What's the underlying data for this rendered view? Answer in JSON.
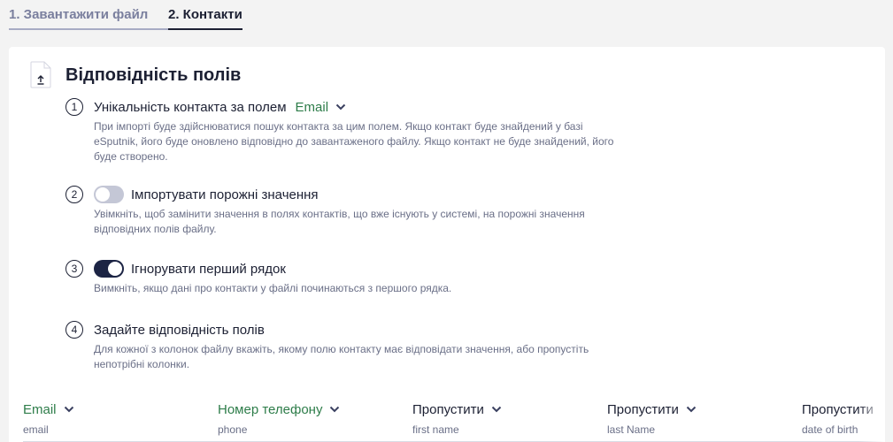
{
  "steps": [
    {
      "label": "1. Завантажити файл"
    },
    {
      "label": "2. Контакти"
    }
  ],
  "section": {
    "title": "Відповідність полів"
  },
  "items": [
    {
      "number": "1",
      "title": "Унікальність контакта за полем",
      "field_value": "Email",
      "description": "При імпорті буде здійснюватися пошук контакта за цим полем. Якщо контакт буде знайдений у базі eSputnik, його буде оновлено відповідно до завантаженого файлу. Якщо контакт не буде знайдений, його буде створено."
    },
    {
      "number": "2",
      "title": "Імпортувати порожні значення",
      "toggle_on": false,
      "description": "Увімкніть, щоб замінити значення в полях контактів, що вже існують у системі, на порожні значення відповідних полів файлу."
    },
    {
      "number": "3",
      "title": "Ігнорувати перший рядок",
      "toggle_on": true,
      "description": "Вимкніть, якщо дані про контакти у файлі починаються з першого рядка."
    },
    {
      "number": "4",
      "title": "Задайте відповідність полів",
      "description": "Для кожної з колонок файлу вкажіть, якому полю контакту має відповідати значення, або пропустіть непотрібні колонки."
    }
  ],
  "columns": [
    {
      "mapping": "Email",
      "file_column": "email",
      "mapped": true
    },
    {
      "mapping": "Номер телефону",
      "file_column": "phone",
      "mapped": true
    },
    {
      "mapping": "Пропустити",
      "file_column": "first name",
      "mapped": false
    },
    {
      "mapping": "Пропустити",
      "file_column": "last Name",
      "mapped": false
    },
    {
      "mapping": "Пропустити",
      "file_column": "date of birth",
      "mapped": false
    }
  ],
  "colors": {
    "accent_green": "#2e7d4a",
    "dark": "#1c2033",
    "toggle_on": "#1c2444",
    "toggle_off": "#c4c7d6"
  }
}
